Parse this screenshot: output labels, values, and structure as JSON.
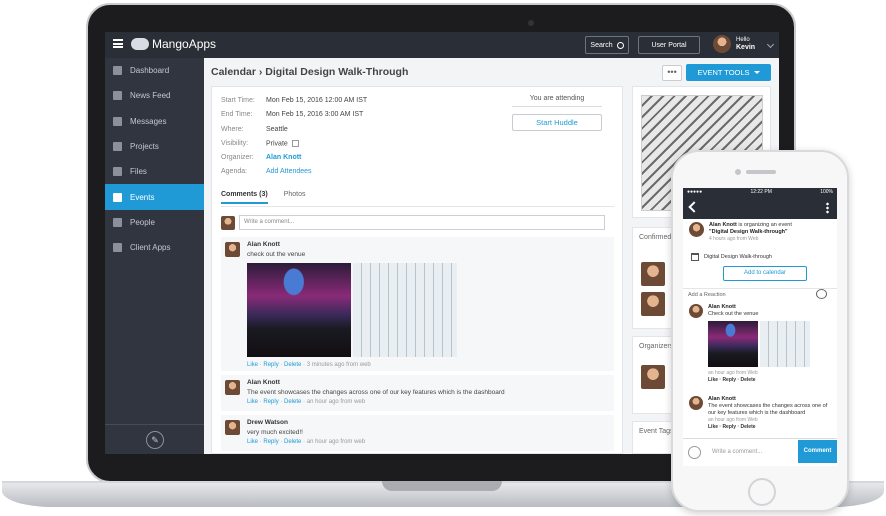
{
  "header": {
    "app_name": "MangoApps",
    "search_label": "Search",
    "portal_label": "User Portal",
    "greeting": "Hello",
    "user_name": "Kevin"
  },
  "sidebar": {
    "items": [
      {
        "label": "Dashboard",
        "icon": "home-icon"
      },
      {
        "label": "News Feed",
        "icon": "inbox-icon"
      },
      {
        "label": "Messages",
        "icon": "mail-icon"
      },
      {
        "label": "Projects",
        "icon": "folder-icon"
      },
      {
        "label": "Files",
        "icon": "file-icon"
      },
      {
        "label": "Events",
        "icon": "calendar-icon",
        "active": true
      },
      {
        "label": "People",
        "icon": "person-icon"
      },
      {
        "label": "Client Apps",
        "icon": "download-icon"
      }
    ]
  },
  "page": {
    "title": "Calendar › Digital Design Walk-Through",
    "more": "•••",
    "tools_label": "EVENT TOOLS"
  },
  "event": {
    "details": [
      {
        "key": "Start Time:",
        "value": "Mon Feb 15, 2016 12:00 AM IST"
      },
      {
        "key": "End Time:",
        "value": "Mon Feb 15, 2016 3:00 AM IST"
      },
      {
        "key": "Where:",
        "value": "Seattle"
      },
      {
        "key": "Visibility:",
        "value": "Private"
      },
      {
        "key": "Organizer:",
        "value": "Alan Knott"
      },
      {
        "key": "Agenda:",
        "value": "Add Attendees"
      }
    ],
    "attending": "You are attending",
    "huddle": "Start Huddle"
  },
  "tabs": {
    "comments": "Comments (3)",
    "photos": "Photos"
  },
  "comment_input": {
    "placeholder": "Write a comment..."
  },
  "comments": [
    {
      "author": "Alan Knott",
      "text": "check out the venue",
      "like": "Like",
      "reply": "Reply",
      "delete": "Delete",
      "time": "3 minutes ago from web"
    },
    {
      "author": "Alan Knott",
      "text": "The event showcases the changes across one of our key features which is the dashboard",
      "like": "Like",
      "reply": "Reply",
      "delete": "Delete",
      "time": "an hour ago from web"
    },
    {
      "author": "Drew Watson",
      "text": "very much excited!!",
      "like": "Like",
      "reply": "Reply",
      "delete": "Delete",
      "time": "an hour ago from web"
    }
  ],
  "right": {
    "confirmed": "Confirmed",
    "organizers": "Organizers",
    "event_tags": "Event Tags"
  },
  "phone": {
    "time": "12:22 PM",
    "carrier": "●●●●● ",
    "battery": "100%",
    "feed_author": "Alan Knott",
    "feed_text": "is organizing an event",
    "feed_event": "\"Digital Design Walk-through\"",
    "feed_time": "4 hours ago from Web",
    "event_name": "Digital Design Walk-through",
    "add_calendar": "Add to calendar",
    "add_reaction": "Add a Reaction",
    "comments": [
      {
        "author": "Alan Knott",
        "text": "Check out the venue",
        "time": "an hour ago from Web",
        "actions": "Like · Reply · Delete"
      },
      {
        "author": "Alan Knott",
        "text": "The event showcases the changes across one of our key features which is the dashboard",
        "time": "an hour ago from Web",
        "actions": "Like · Reply · Delete"
      }
    ],
    "input_placeholder": "Write a comment...",
    "send": "Comment"
  }
}
